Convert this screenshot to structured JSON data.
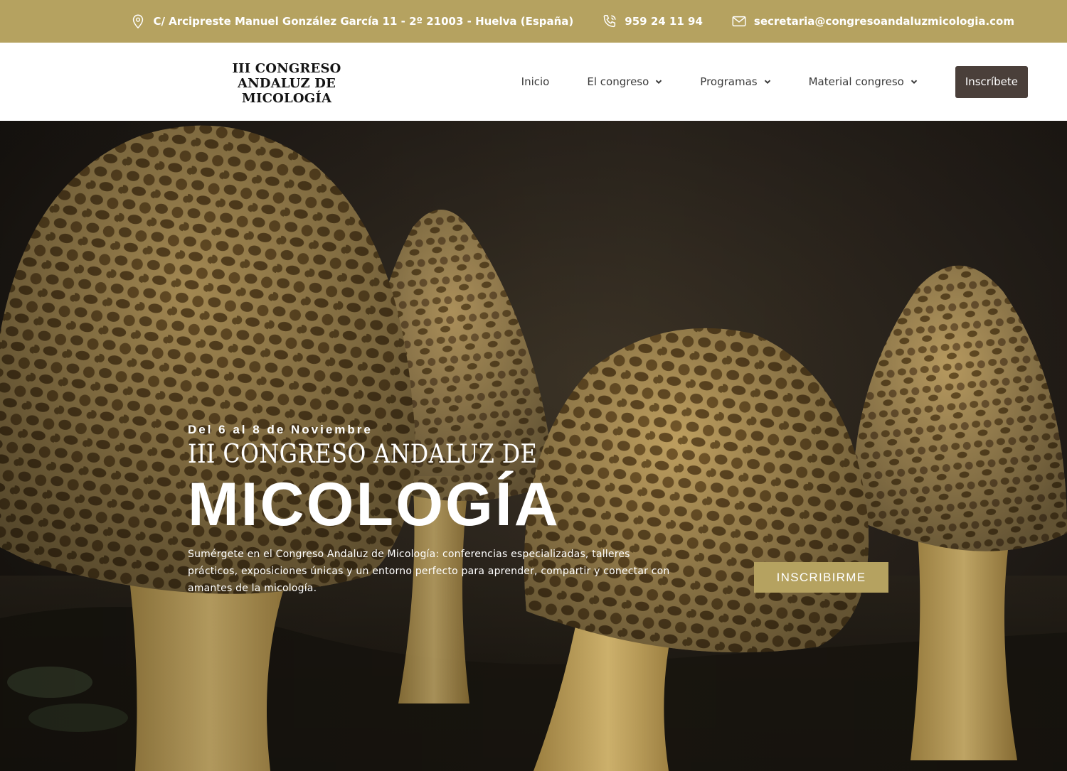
{
  "topbar": {
    "address": "C/ Arcipreste Manuel González García 11 - 2º 21003 - Huelva (España)",
    "phone": "959 24 11 94",
    "email": "secretaria@congresoandaluzmicologia.com",
    "icons": [
      "map-pin-icon",
      "phone-icon",
      "envelope-icon"
    ],
    "background": "#b5a260"
  },
  "header": {
    "logo_lines": [
      "III CONGRESO",
      "ANDALUZ DE",
      "MICOLOGÍA"
    ],
    "nav": [
      {
        "label": "Inicio",
        "has_dropdown": false
      },
      {
        "label": "El congreso",
        "has_dropdown": true
      },
      {
        "label": "Programas",
        "has_dropdown": true
      },
      {
        "label": "Material congreso",
        "has_dropdown": true
      }
    ],
    "cta_label": "Inscríbete",
    "cta_color": "#4a3f3a"
  },
  "hero": {
    "date": "Del 6 al 8 de Noviembre",
    "title_line1": "III CONGRESO ANDALUZ DE",
    "title_line2": "MICOLOGÍA",
    "description": "Sumérgete en el Congreso Andaluz de Micología: conferencias especializadas, talleres prácticos, exposiciones únicas y un entorno perfecto para aprender, compartir y conectar con amantes de la micología.",
    "button_label": "INSCRIBIRME",
    "button_color": "#b5a260"
  }
}
